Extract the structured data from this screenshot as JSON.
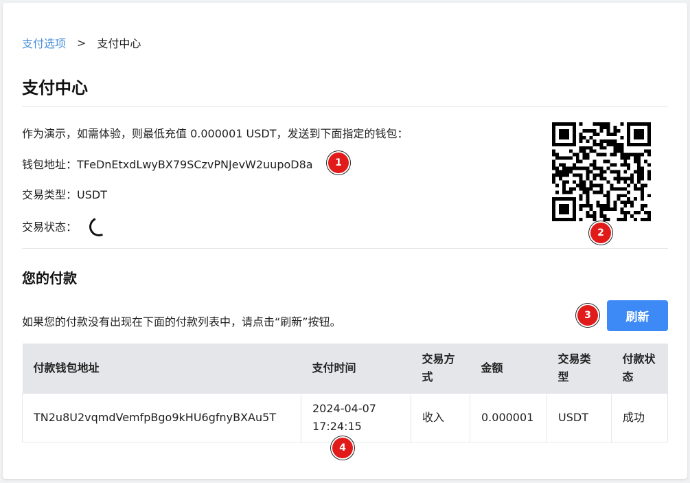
{
  "breadcrumb": {
    "parent": "支付选项",
    "separator": ">",
    "current": "支付中心"
  },
  "page_title": "支付中心",
  "info": {
    "demo_notice": "作为演示，如需体验，则最低充值 0.000001 USDT，发送到下面指定的钱包：",
    "wallet_label": "钱包地址：",
    "wallet_address": "TFeDnEtxdLwyBX79SCzvPNJevW2uupoD8a",
    "type_label": "交易类型：",
    "type_value": "USDT",
    "status_label": "交易状态："
  },
  "your_payments": {
    "title": "您的付款",
    "hint": "如果您的付款没有出现在下面的付款列表中，请点击“刷新”按钮。",
    "refresh_label": "刷新"
  },
  "table": {
    "headers": [
      "付款钱包地址",
      "支付时间",
      "交易方式",
      "金额",
      "交易类型",
      "付款状态"
    ],
    "rows": [
      {
        "address": "TN2u8U2vqmdVemfpBgo9kHU6gfnyBXAu5T",
        "date": "2024-04-07",
        "time": "17:24:15",
        "method": "收入",
        "amount": "0.000001",
        "type": "USDT",
        "status": "成功"
      }
    ]
  },
  "badges": [
    "1",
    "2",
    "3",
    "4"
  ],
  "colors": {
    "accent": "#3d8af7",
    "link": "#4a8fd8",
    "badge": "#e11a1a",
    "table_header_bg": "#e4e6ea"
  },
  "icons": {
    "status": "loading-spinner-icon",
    "qr": "qr-code-icon"
  }
}
